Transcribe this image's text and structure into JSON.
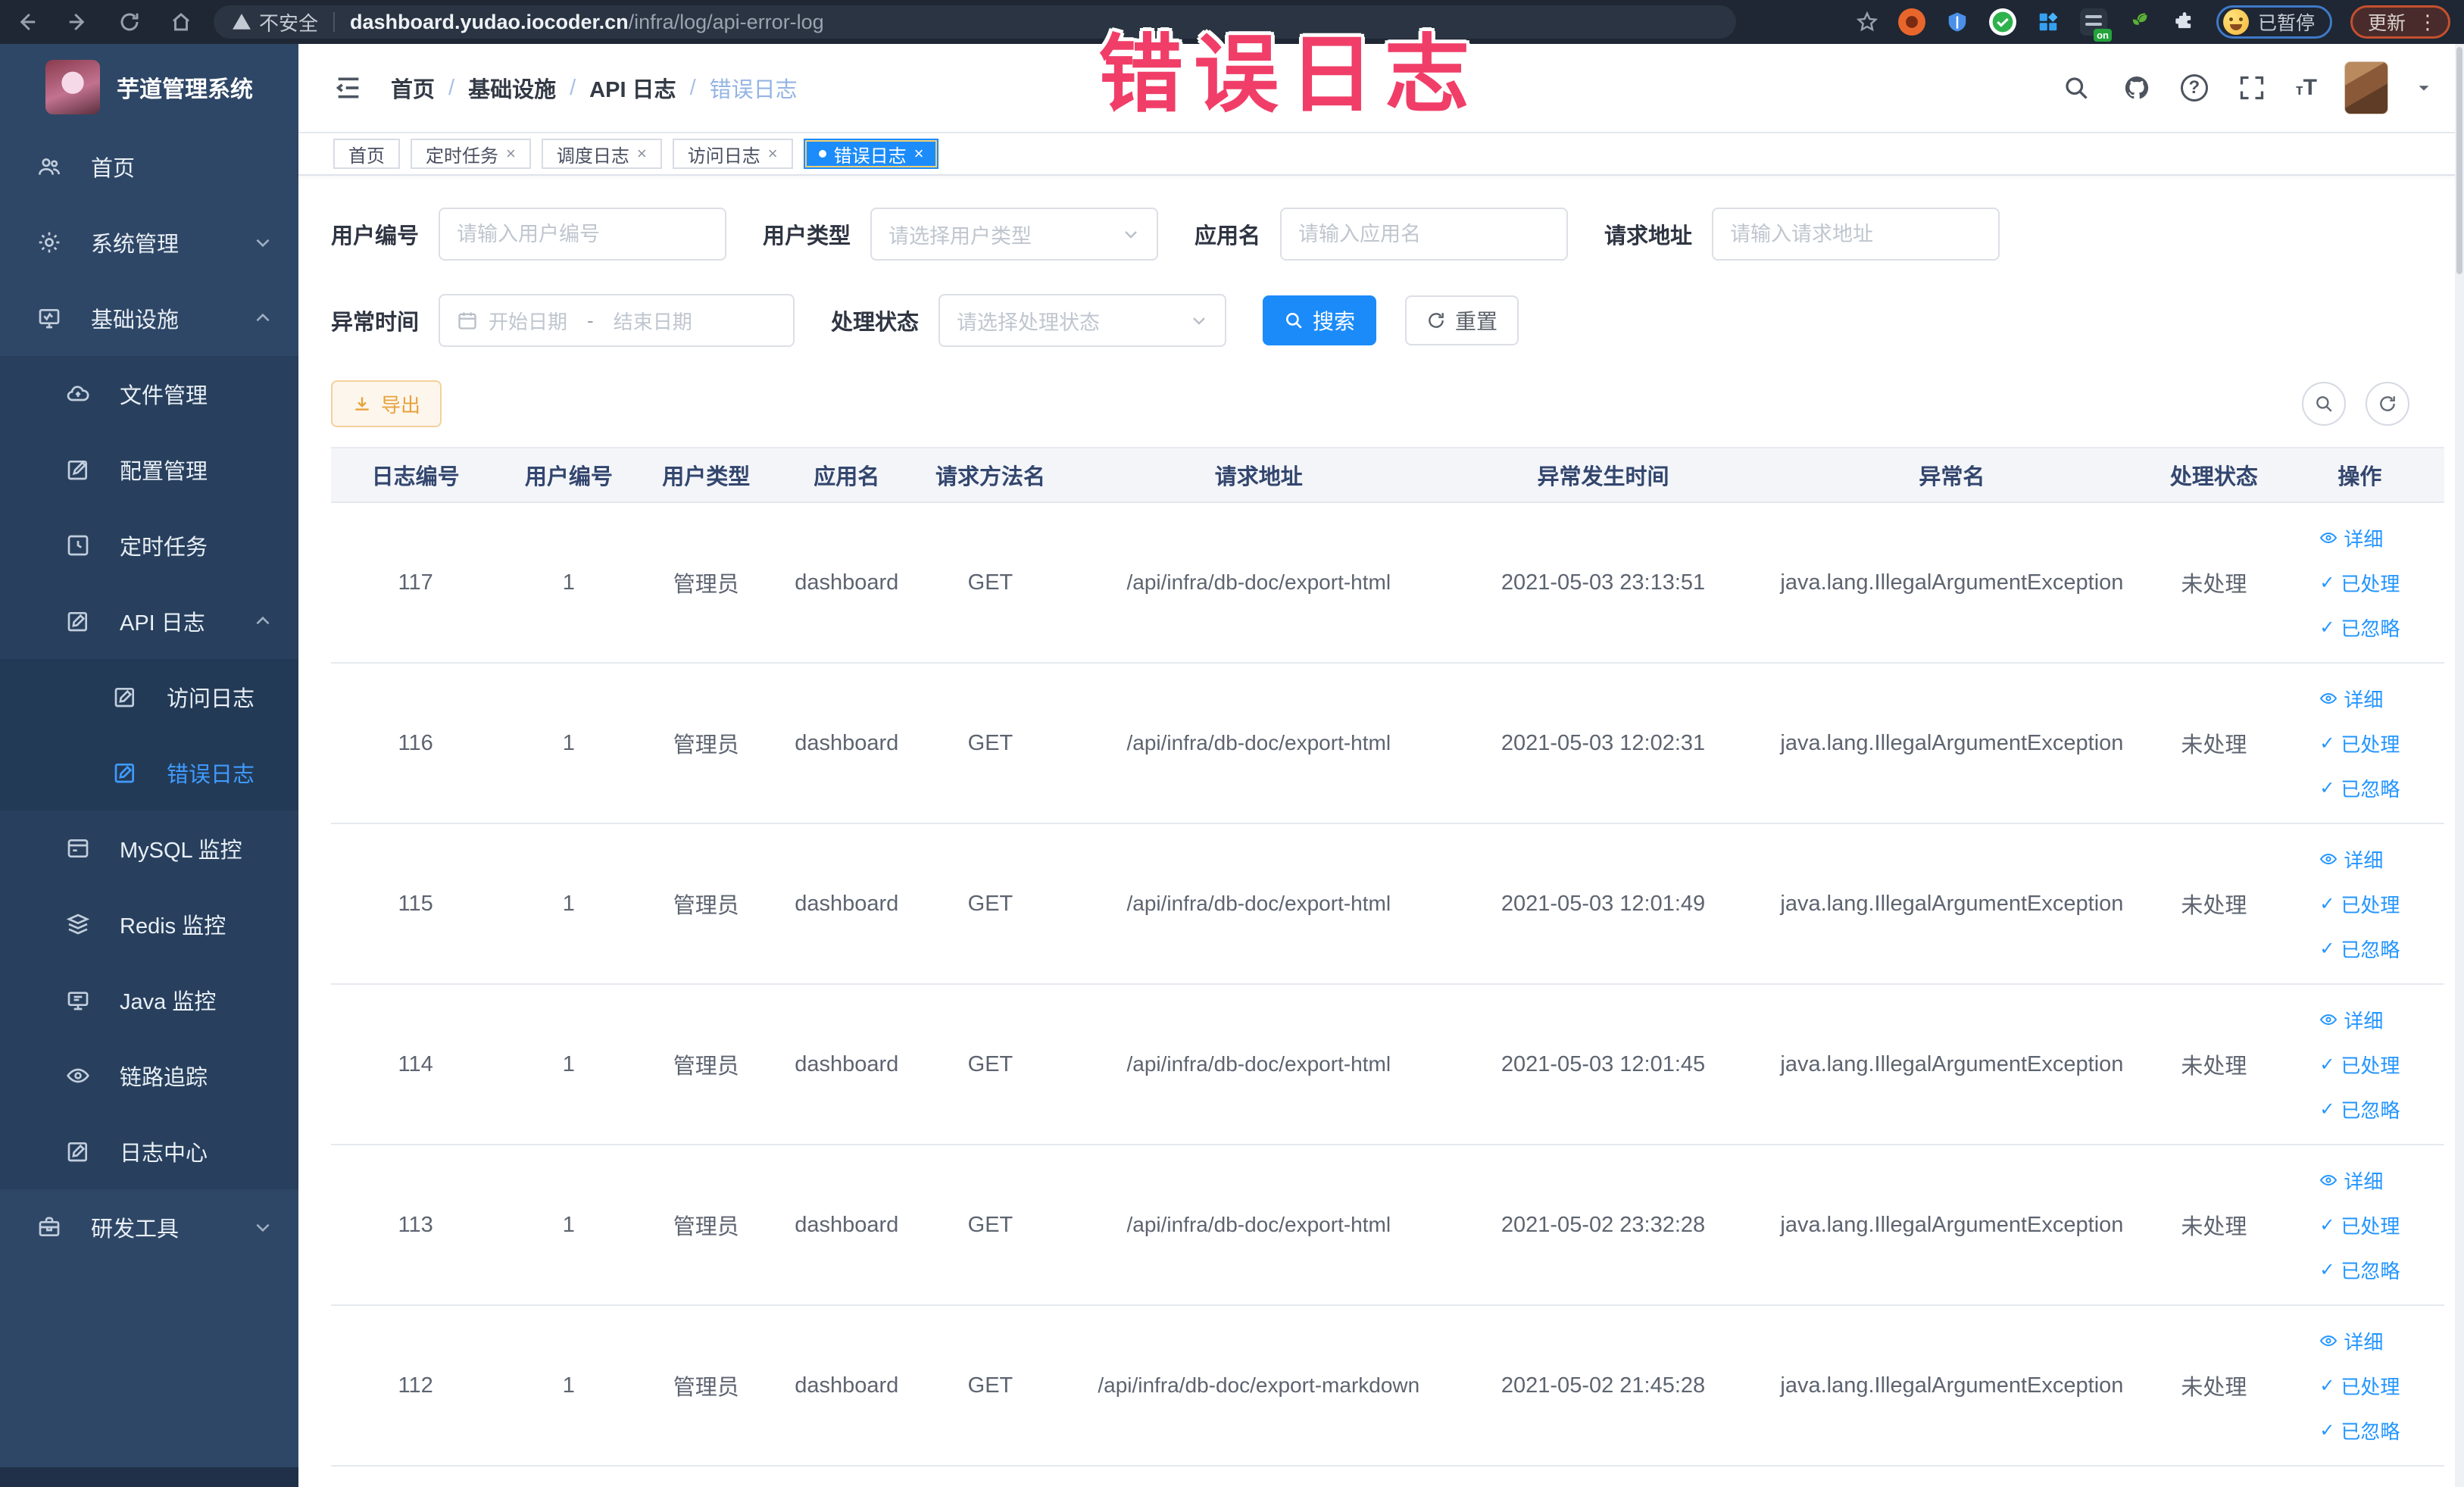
{
  "colors": {
    "accent_blue": "#1b8bf9",
    "link_blue": "#2395ff",
    "sidebar_bg": "#2f4766",
    "sidebar_submenu_bg": "#28405d",
    "sidebar_active": "#3f9bff",
    "warning_orange": "#e6a23c",
    "overlay_pink": "#f03e68",
    "browser_bar_bg": "#1e2733"
  },
  "overlay": {
    "title": "错误日志"
  },
  "browser": {
    "security_label": "不安全",
    "url_host": "dashboard.yudao.iocoder.cn",
    "url_path": "/infra/log/api-error-log",
    "paused_chip": "已暂停",
    "update_button": "更新",
    "ext_badge": "on"
  },
  "sidebar": {
    "app_title": "芋道管理系统",
    "items": [
      {
        "label": "首页"
      },
      {
        "label": "系统管理"
      },
      {
        "label": "基础设施"
      },
      {
        "label": "文件管理"
      },
      {
        "label": "配置管理"
      },
      {
        "label": "定时任务"
      },
      {
        "label": "API 日志"
      },
      {
        "label": "访问日志"
      },
      {
        "label": "错误日志"
      },
      {
        "label": "MySQL 监控"
      },
      {
        "label": "Redis 监控"
      },
      {
        "label": "Java 监控"
      },
      {
        "label": "链路追踪"
      },
      {
        "label": "日志中心"
      },
      {
        "label": "研发工具"
      }
    ]
  },
  "navbar": {
    "breadcrumb": [
      "首页",
      "基础设施",
      "API 日志",
      "错误日志"
    ],
    "separator": "/"
  },
  "tabs": [
    {
      "label": "首页"
    },
    {
      "label": "定时任务"
    },
    {
      "label": "调度日志"
    },
    {
      "label": "访问日志"
    },
    {
      "label": "错误日志"
    }
  ],
  "filters": {
    "user_id": {
      "label": "用户编号",
      "placeholder": "请输入用户编号"
    },
    "user_type": {
      "label": "用户类型",
      "placeholder": "请选择用户类型"
    },
    "app_name": {
      "label": "应用名",
      "placeholder": "请输入应用名"
    },
    "request_url": {
      "label": "请求地址",
      "placeholder": "请输入请求地址"
    },
    "exception_time": {
      "label": "异常时间",
      "start_placeholder": "开始日期",
      "range_separator": "-",
      "end_placeholder": "结束日期"
    },
    "process_status": {
      "label": "处理状态",
      "placeholder": "请选择处理状态"
    },
    "search_label": "搜索",
    "reset_label": "重置"
  },
  "toolbar": {
    "export_label": "导出"
  },
  "table": {
    "headers": [
      "日志编号",
      "用户编号",
      "用户类型",
      "应用名",
      "请求方法名",
      "请求地址",
      "异常发生时间",
      "异常名",
      "处理状态",
      "操作"
    ],
    "actions": {
      "detail": "详细",
      "processed": "已处理",
      "ignored": "已忽略"
    },
    "rows": [
      {
        "id": "117",
        "user_id": "1",
        "user_type": "管理员",
        "app": "dashboard",
        "method": "GET",
        "url": "/api/infra/db-doc/export-html",
        "time": "2021-05-03 23:13:51",
        "exception": "java.lang.IllegalArgumentException",
        "status": "未处理"
      },
      {
        "id": "116",
        "user_id": "1",
        "user_type": "管理员",
        "app": "dashboard",
        "method": "GET",
        "url": "/api/infra/db-doc/export-html",
        "time": "2021-05-03 12:02:31",
        "exception": "java.lang.IllegalArgumentException",
        "status": "未处理"
      },
      {
        "id": "115",
        "user_id": "1",
        "user_type": "管理员",
        "app": "dashboard",
        "method": "GET",
        "url": "/api/infra/db-doc/export-html",
        "time": "2021-05-03 12:01:49",
        "exception": "java.lang.IllegalArgumentException",
        "status": "未处理"
      },
      {
        "id": "114",
        "user_id": "1",
        "user_type": "管理员",
        "app": "dashboard",
        "method": "GET",
        "url": "/api/infra/db-doc/export-html",
        "time": "2021-05-03 12:01:45",
        "exception": "java.lang.IllegalArgumentException",
        "status": "未处理"
      },
      {
        "id": "113",
        "user_id": "1",
        "user_type": "管理员",
        "app": "dashboard",
        "method": "GET",
        "url": "/api/infra/db-doc/export-html",
        "time": "2021-05-02 23:32:28",
        "exception": "java.lang.IllegalArgumentException",
        "status": "未处理"
      },
      {
        "id": "112",
        "user_id": "1",
        "user_type": "管理员",
        "app": "dashboard",
        "method": "GET",
        "url": "/api/infra/db-doc/export-markdown",
        "time": "2021-05-02 21:45:28",
        "exception": "java.lang.IllegalArgumentException",
        "status": "未处理"
      }
    ]
  }
}
